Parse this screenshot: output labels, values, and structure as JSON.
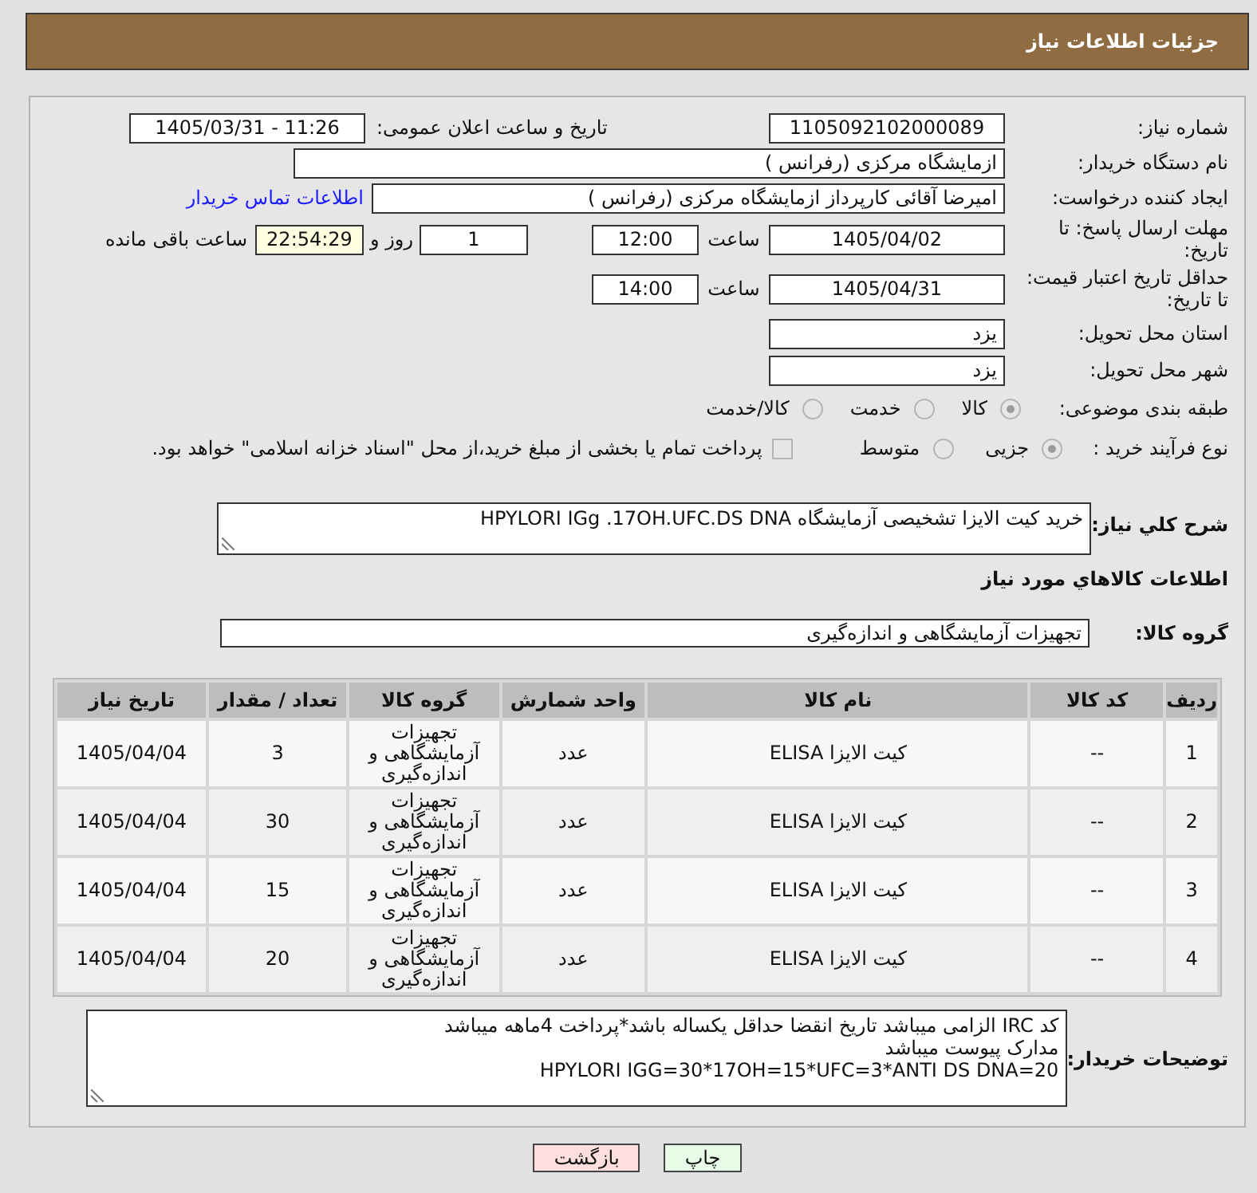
{
  "header": {
    "title": "جزئیات اطلاعات نیاز"
  },
  "need_info": {
    "need_number": {
      "label": "شماره نیاز:",
      "value": "1105092102000089"
    },
    "announce_datetime": {
      "label": "تاریخ و ساعت اعلان عمومی:",
      "value": "1405/03/31 - 11:26"
    },
    "buyer_org": {
      "label": "نام دستگاه خریدار:",
      "value": "ازمایشگاه مرکزی (رفرانس )"
    },
    "requester": {
      "label": "ایجاد کننده درخواست:",
      "value": "امیرضا آقائی کارپرداز ازمایشگاه مرکزی (رفرانس )",
      "link": "اطلاعات تماس خریدار"
    },
    "reply_deadline": {
      "label": "مهلت ارسال پاسخ: تا تاریخ:",
      "date": "1405/04/02",
      "time_label": "ساعت",
      "time": "12:00",
      "days": "1",
      "days_label": "روز و",
      "remaining": "22:54:29",
      "remaining_label": "ساعت باقی مانده"
    },
    "price_validity": {
      "label": "حداقل تاریخ اعتبار قیمت: تا تاریخ:",
      "date": "1405/04/31",
      "time_label": "ساعت",
      "time": "14:00"
    },
    "delivery_province": {
      "label": "استان محل تحویل:",
      "value": "یزد"
    },
    "delivery_city": {
      "label": "شهر محل تحویل:",
      "value": "یزد"
    },
    "category": {
      "label": "طبقه بندی موضوعی:",
      "disabled": true,
      "options": [
        {
          "label": "کالا",
          "selected": true
        },
        {
          "label": "خدمت",
          "selected": false
        },
        {
          "label": "کالا/خدمت",
          "selected": false
        }
      ]
    },
    "purchase_type": {
      "label": "نوع فرآیند خرید :",
      "disabled": true,
      "options": [
        {
          "label": "جزیی",
          "selected": true
        },
        {
          "label": "متوسط",
          "selected": false
        }
      ],
      "treasury_checkbox": {
        "label": "پرداخت تمام یا بخشی از مبلغ خرید،از محل \"اسناد خزانه اسلامی\" خواهد بود.",
        "checked": false
      }
    },
    "description": {
      "label": "شرح کلي نياز:",
      "value": "خرید کیت الایزا تشخیصی آزمایشگاه HPYLORI IGg .17OH.UFC.DS DNA"
    }
  },
  "goods": {
    "heading": "اطلاعات کالاهاي مورد نياز",
    "group": {
      "label": "گروه کالا:",
      "value": "تجهیزات آزمایشگاهی و اندازه‌گیری"
    },
    "table": {
      "columns": [
        "ردیف",
        "کد کالا",
        "نام کالا",
        "واحد شمارش",
        "گروه کالا",
        "تعداد / مقدار",
        "تاریخ نیاز"
      ],
      "rows": [
        {
          "cells": [
            "1",
            "--",
            "کیت الایزا ELISA",
            "عدد",
            "تجهیزات آزمایشگاهی و اندازه‌گیری",
            "3",
            "1405/04/04"
          ]
        },
        {
          "cells": [
            "2",
            "--",
            "کیت الایزا ELISA",
            "عدد",
            "تجهیزات آزمایشگاهی و اندازه‌گیری",
            "30",
            "1405/04/04"
          ]
        },
        {
          "cells": [
            "3",
            "--",
            "کیت الایزا ELISA",
            "عدد",
            "تجهیزات آزمایشگاهی و اندازه‌گیری",
            "15",
            "1405/04/04"
          ]
        },
        {
          "cells": [
            "4",
            "--",
            "کیت الایزا ELISA",
            "عدد",
            "تجهیزات آزمایشگاهی و اندازه‌گیری",
            "20",
            "1405/04/04"
          ]
        }
      ]
    }
  },
  "buyer_notes": {
    "label": "توضیحات خریدار:",
    "lines": [
      "کد IRC الزامی میباشد تاریخ انقضا حداقل یکساله باشد*پرداخت 4ماهه میباشد",
      "مدارک پیوست میباشد",
      "HPYLORI IGG=30*17OH=15*UFC=3*ANTI DS DNA=20"
    ]
  },
  "buttons": [
    {
      "label": "چاپ",
      "kind": "print"
    },
    {
      "label": "بازگشت",
      "kind": "back"
    }
  ]
}
